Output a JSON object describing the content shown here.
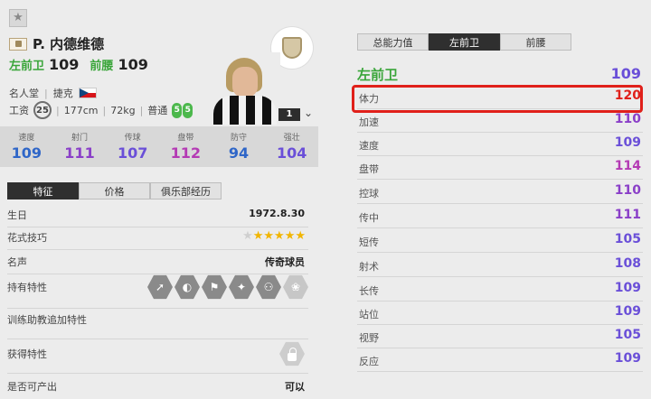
{
  "colors": {
    "accent_green": "#3aa53a",
    "stat_blue": "#2f66c8",
    "stat_purple": "#8a3fc8",
    "stat_violet": "#6a4fd8",
    "stat_pink": "#b43ab4",
    "highlight_red": "#e0201a"
  },
  "header": {
    "favorite_icon": "star-icon",
    "player_name": "P. 内德维德",
    "positions": [
      {
        "label": "左前卫",
        "value": "109"
      },
      {
        "label": "前腰",
        "value": "109"
      }
    ],
    "info": {
      "category": "名人堂",
      "nation": "捷克",
      "wage_label": "工资",
      "wage": "25",
      "height": "177cm",
      "weight": "72kg",
      "body_type": "普通",
      "foot_left": "5",
      "foot_right": "5"
    },
    "level": "1"
  },
  "stats": [
    {
      "label": "速度",
      "value": "109",
      "color": "#2f66c8"
    },
    {
      "label": "射门",
      "value": "111",
      "color": "#8a3fc8"
    },
    {
      "label": "传球",
      "value": "107",
      "color": "#6a4fd8"
    },
    {
      "label": "盘带",
      "value": "112",
      "color": "#b43ab4"
    },
    {
      "label": "防守",
      "value": "94",
      "color": "#2f66c8"
    },
    {
      "label": "强壮",
      "value": "104",
      "color": "#6a4fd8"
    }
  ],
  "left_tabs": [
    {
      "label": "特征",
      "active": true
    },
    {
      "label": "价格",
      "active": false
    },
    {
      "label": "俱乐部经历",
      "active": false
    }
  ],
  "details": {
    "birthday_label": "生日",
    "birthday": "1972.8.30",
    "skill_label": "花式技巧",
    "skill_stars": 5,
    "reputation_label": "名声",
    "reputation": "传奇球员",
    "traits_label": "持有特性",
    "trait_icons": [
      "long-shot-icon",
      "dribble-icon",
      "tackle-icon",
      "power-shot-icon",
      "team-player-icon",
      "stamina-icon"
    ],
    "training_label": "训练助教追加特性",
    "acquired_label": "获得特性",
    "producible_label": "是否可产出",
    "producible": "可以"
  },
  "right_tabs": [
    {
      "label": "总能力值",
      "active": false
    },
    {
      "label": "左前卫",
      "active": true
    },
    {
      "label": "前腰",
      "active": false
    }
  ],
  "position_panel": {
    "title": "左前卫",
    "overall": "109",
    "attributes": [
      {
        "label": "体力",
        "value": "120",
        "color": "#e0201a"
      },
      {
        "label": "加速",
        "value": "110",
        "color": "#8a3fc8"
      },
      {
        "label": "速度",
        "value": "109",
        "color": "#6a4fd8"
      },
      {
        "label": "盘带",
        "value": "114",
        "color": "#b43ab4"
      },
      {
        "label": "控球",
        "value": "110",
        "color": "#8a3fc8"
      },
      {
        "label": "传中",
        "value": "111",
        "color": "#8a3fc8"
      },
      {
        "label": "短传",
        "value": "105",
        "color": "#6a4fd8"
      },
      {
        "label": "射术",
        "value": "108",
        "color": "#6a4fd8"
      },
      {
        "label": "长传",
        "value": "109",
        "color": "#6a4fd8"
      },
      {
        "label": "站位",
        "value": "109",
        "color": "#6a4fd8"
      },
      {
        "label": "视野",
        "value": "105",
        "color": "#6a4fd8"
      },
      {
        "label": "反应",
        "value": "109",
        "color": "#6a4fd8"
      }
    ]
  }
}
